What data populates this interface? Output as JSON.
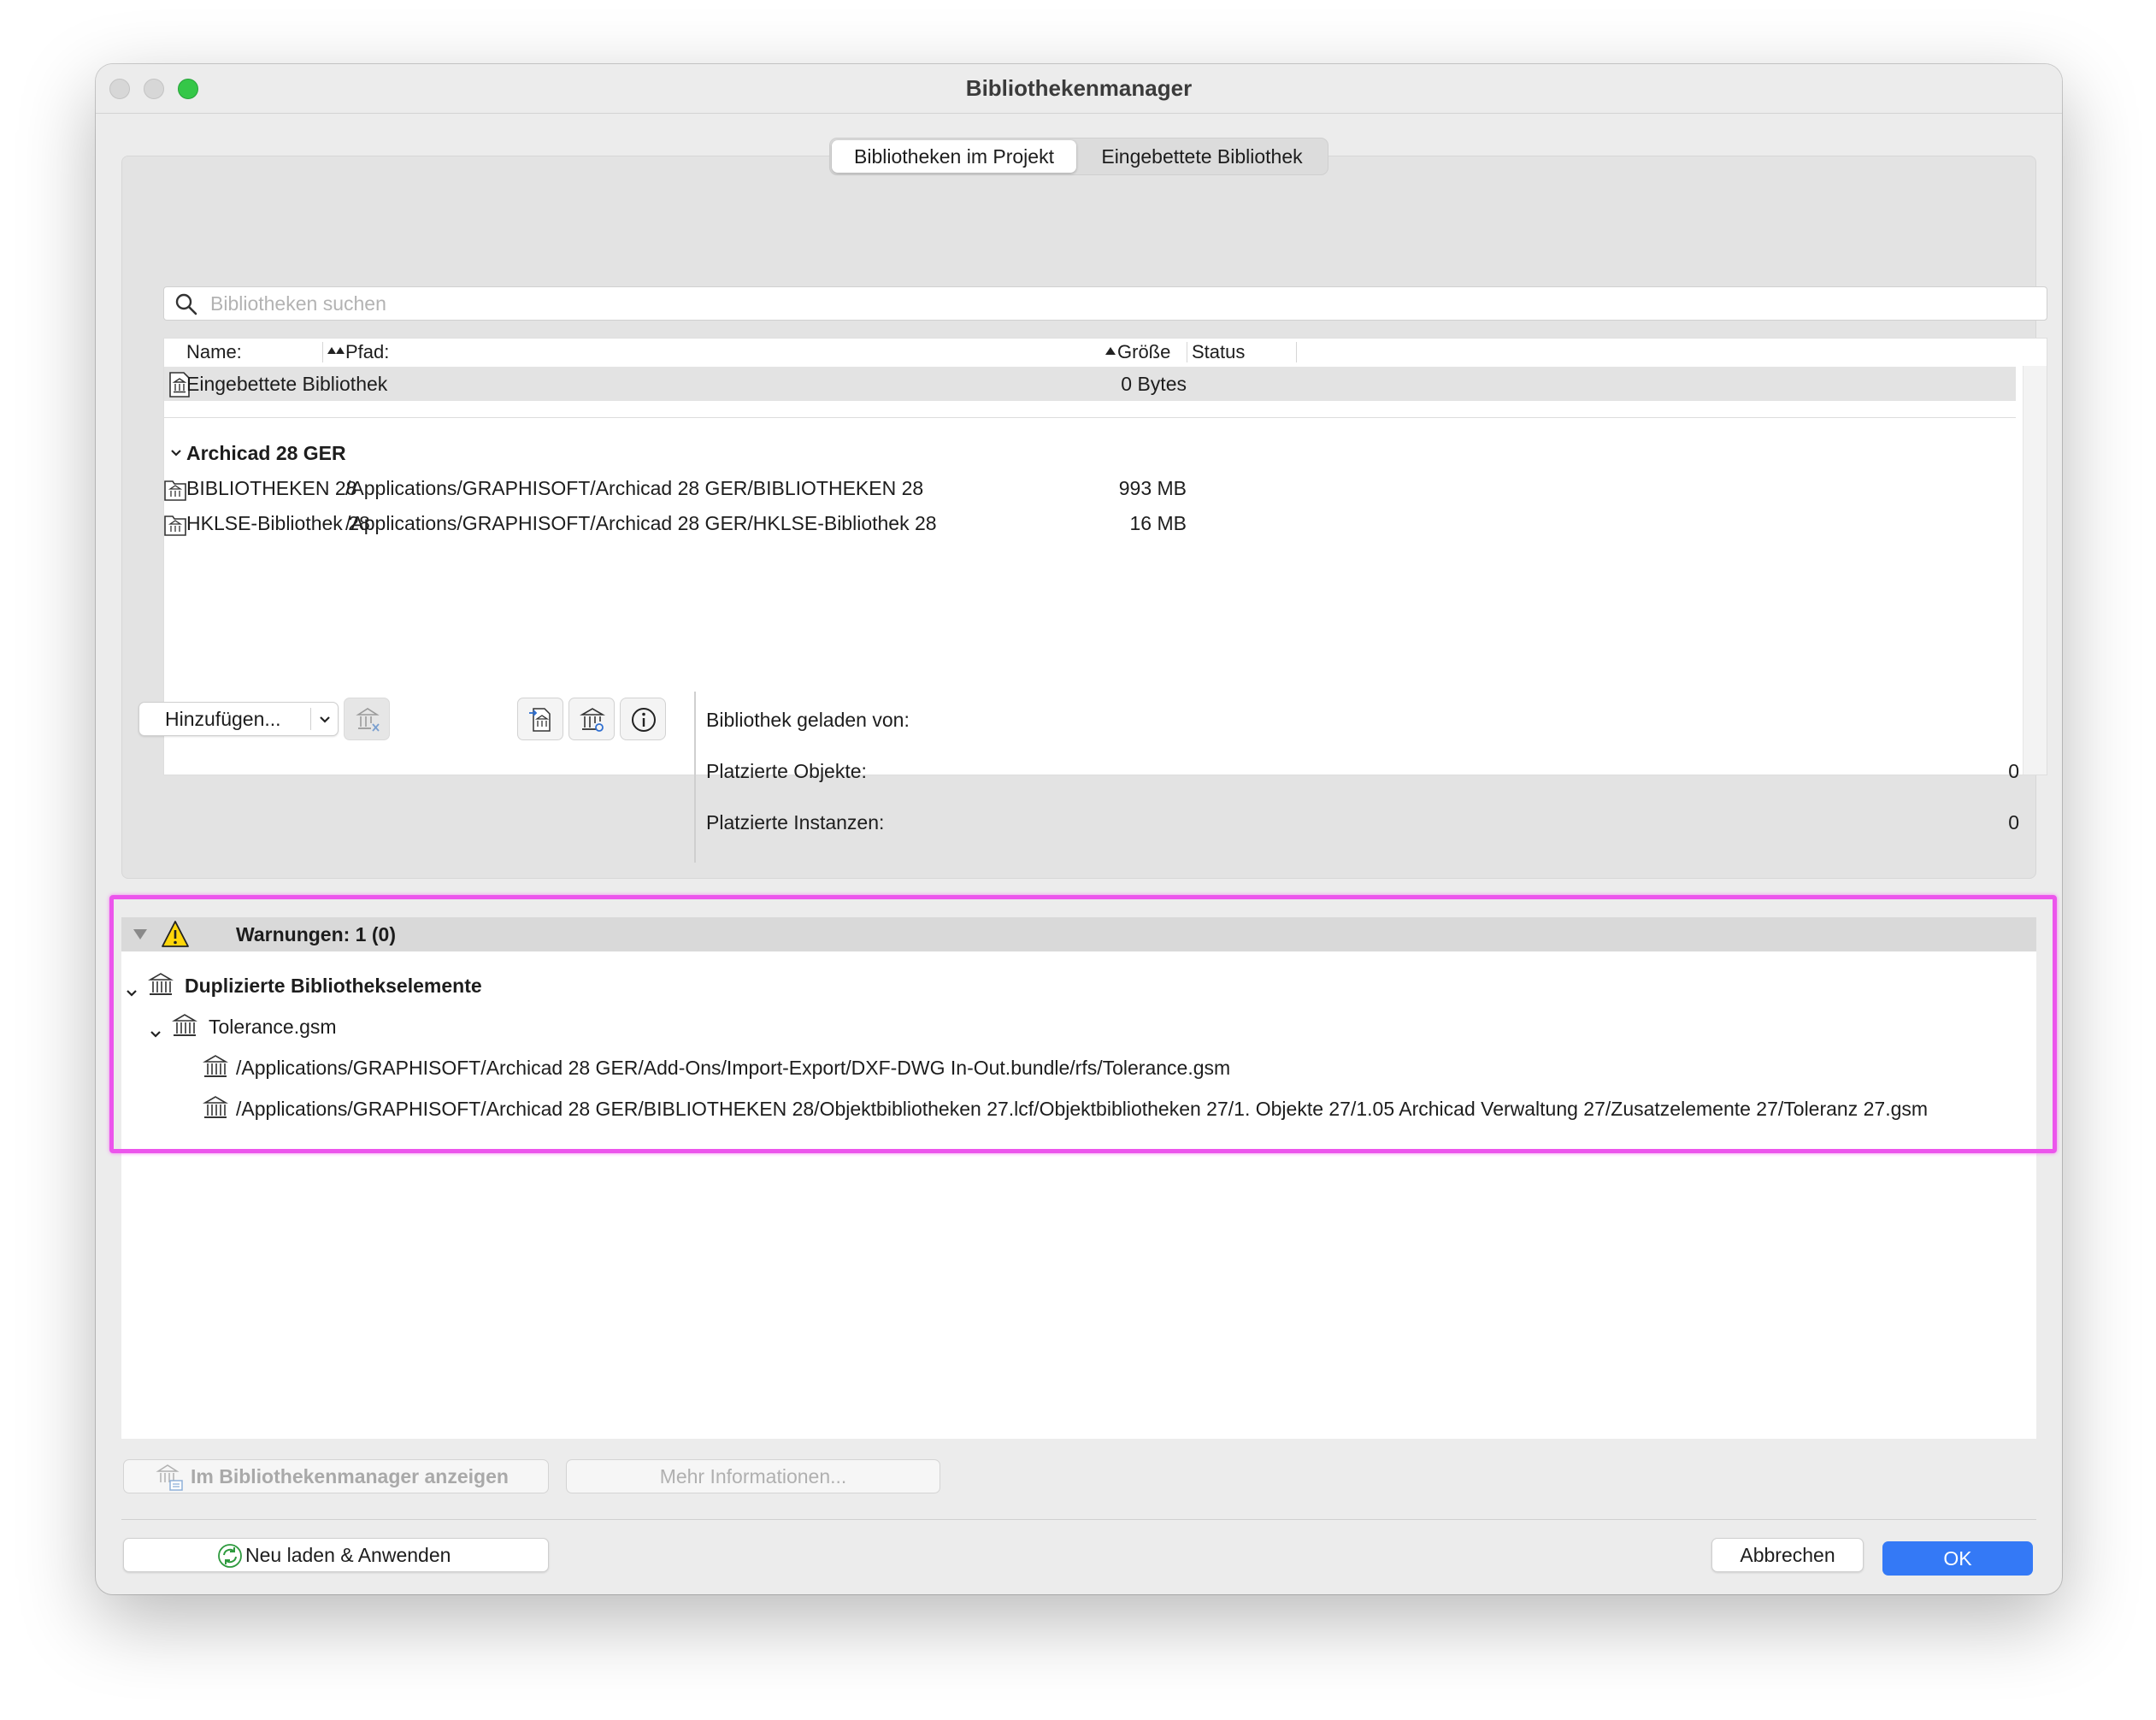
{
  "window": {
    "title": "Bibliothekenmanager"
  },
  "tabs": [
    {
      "label": "Bibliotheken im Projekt",
      "active": true
    },
    {
      "label": "Eingebettete Bibliothek",
      "active": false
    }
  ],
  "search": {
    "placeholder": "Bibliotheken suchen"
  },
  "columns": {
    "name": "Name:",
    "path": "Pfad:",
    "size": "Größe",
    "status": "Status"
  },
  "embedded_row": {
    "name": "Eingebettete Bibliothek",
    "size": "0 Bytes"
  },
  "group": {
    "label": "Archicad 28 GER",
    "rows": [
      {
        "name": "BIBLIOTHEKEN 28",
        "path": "/Applications/GRAPHISOFT/Archicad 28 GER/BIBLIOTHEKEN 28",
        "size": "993 MB"
      },
      {
        "name": "HKLSE-Bibliothek 28",
        "path": "/Applications/GRAPHISOFT/Archicad 28 GER/HKLSE-Bibliothek 28",
        "size": "16 MB"
      }
    ]
  },
  "toolbar": {
    "add_label": "Hinzufügen..."
  },
  "info": {
    "loaded_from_label": "Bibliothek geladen von:",
    "placed_objects_label": "Platzierte Objekte:",
    "placed_objects_value": "0",
    "placed_instances_label": "Platzierte Instanzen:",
    "placed_instances_value": "0"
  },
  "warnings": {
    "title": "Warnungen: 1 (0)",
    "category": "Duplizierte Bibliothekselemente",
    "item": "Tolerance.gsm",
    "paths": [
      "/Applications/GRAPHISOFT/Archicad 28 GER/Add-Ons/Import-Export/DXF-DWG In-Out.bundle/rfs/Tolerance.gsm",
      "/Applications/GRAPHISOFT/Archicad 28 GER/BIBLIOTHEKEN 28/Objektbibliotheken 27.lcf/Objektbibliotheken 27/1. Objekte 27/1.05 Archicad Verwaltung 27/Zusatzelemente 27/Toleranz 27.gsm"
    ]
  },
  "buttons": {
    "show_in_manager": "Im Bibliothekenmanager anzeigen",
    "more_info": "Mehr Informationen...",
    "reload_apply": "Neu laden & Anwenden",
    "cancel": "Abbrechen",
    "ok": "OK"
  },
  "colors": {
    "ok_button": "#3479f6",
    "highlight": "#ec55ec",
    "traffic_green": "#35c748"
  }
}
